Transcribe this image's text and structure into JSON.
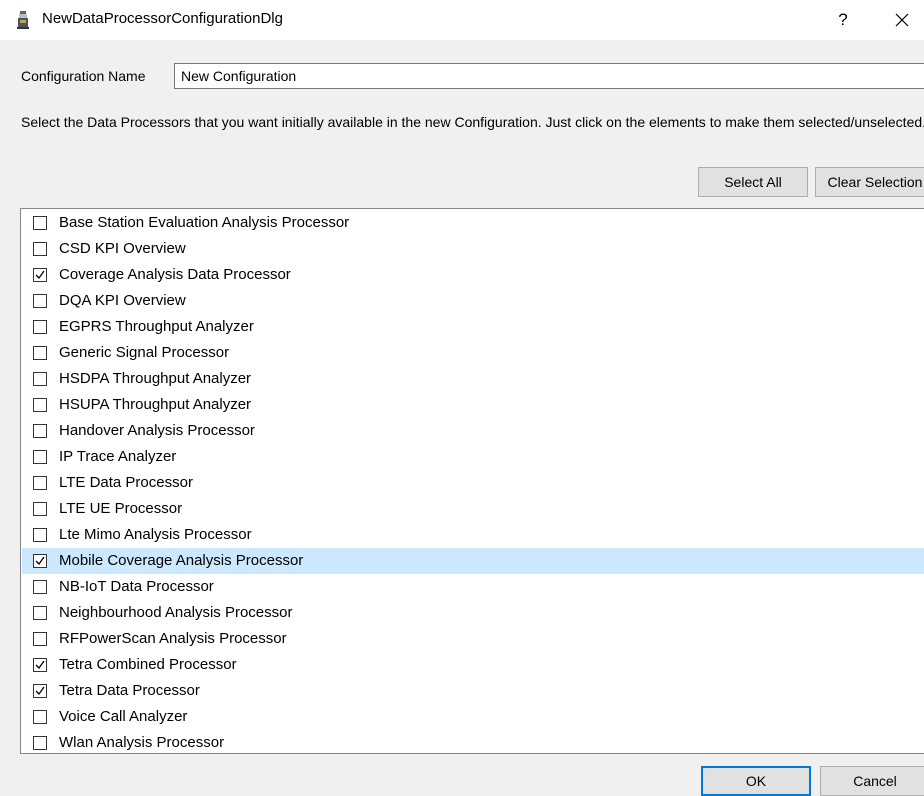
{
  "window": {
    "title": "NewDataProcessorConfigurationDlg",
    "help_label": "?"
  },
  "config": {
    "label": "Configuration Name",
    "value": "New Configuration"
  },
  "description": "Select the Data Processors that you want initially available in the new Configuration. Just click on the elements to make them selected/unselected.",
  "buttons": {
    "select_all": "Select All",
    "clear_selection": "Clear Selection",
    "ok": "OK",
    "cancel": "Cancel"
  },
  "processors": [
    {
      "label": "Base Station Evaluation Analysis Processor",
      "checked": false,
      "highlighted": false
    },
    {
      "label": "CSD KPI Overview",
      "checked": false,
      "highlighted": false
    },
    {
      "label": "Coverage Analysis Data Processor",
      "checked": true,
      "highlighted": false
    },
    {
      "label": "DQA KPI Overview",
      "checked": false,
      "highlighted": false
    },
    {
      "label": "EGPRS Throughput Analyzer",
      "checked": false,
      "highlighted": false
    },
    {
      "label": "Generic Signal Processor",
      "checked": false,
      "highlighted": false
    },
    {
      "label": "HSDPA Throughput Analyzer",
      "checked": false,
      "highlighted": false
    },
    {
      "label": "HSUPA Throughput Analyzer",
      "checked": false,
      "highlighted": false
    },
    {
      "label": "Handover Analysis Processor",
      "checked": false,
      "highlighted": false
    },
    {
      "label": "IP Trace Analyzer",
      "checked": false,
      "highlighted": false
    },
    {
      "label": "LTE Data Processor",
      "checked": false,
      "highlighted": false
    },
    {
      "label": "LTE UE Processor",
      "checked": false,
      "highlighted": false
    },
    {
      "label": "Lte Mimo Analysis Processor",
      "checked": false,
      "highlighted": false
    },
    {
      "label": "Mobile Coverage Analysis Processor",
      "checked": true,
      "highlighted": true
    },
    {
      "label": "NB-IoT Data Processor",
      "checked": false,
      "highlighted": false
    },
    {
      "label": "Neighbourhood Analysis Processor",
      "checked": false,
      "highlighted": false
    },
    {
      "label": "RFPowerScan Analysis Processor",
      "checked": false,
      "highlighted": false
    },
    {
      "label": "Tetra Combined Processor",
      "checked": true,
      "highlighted": false
    },
    {
      "label": "Tetra Data Processor",
      "checked": true,
      "highlighted": false
    },
    {
      "label": "Voice Call Analyzer",
      "checked": false,
      "highlighted": false
    },
    {
      "label": "Wlan Analysis Processor",
      "checked": false,
      "highlighted": false
    }
  ]
}
